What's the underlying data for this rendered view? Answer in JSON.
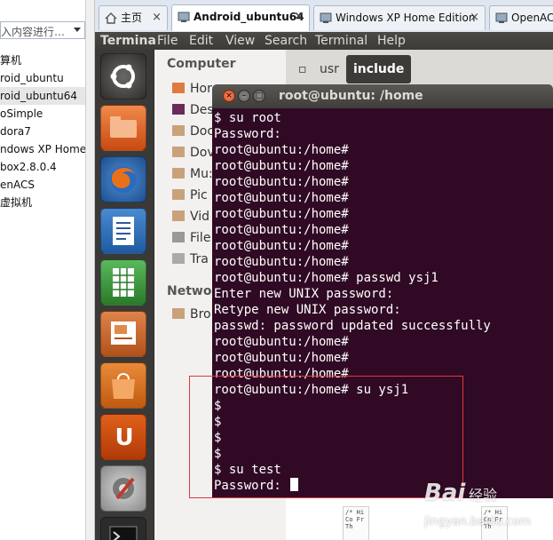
{
  "host": {
    "search_placeholder": "入内容进行…",
    "list_items": [
      "算机",
      "roid_ubuntu",
      "roid_ubuntu64",
      "oSimple",
      "dora7",
      "ndows XP Home E",
      "box2.8.0.4",
      "enACS",
      "虚拟机"
    ],
    "tabs": [
      {
        "label": "主页",
        "icon": "home-icon"
      },
      {
        "label": "Android_ubuntu64",
        "icon": "vm-icon"
      },
      {
        "label": "Windows XP Home Edition",
        "icon": "vm-icon"
      },
      {
        "label": "OpenACS",
        "icon": "vm-icon"
      }
    ],
    "close_glyph": "×"
  },
  "guest": {
    "topbar": {
      "app_name": "Termina",
      "menu": [
        "File",
        "Edit",
        "View",
        "Search",
        "Terminal",
        "Help"
      ]
    },
    "launcher": [
      {
        "name": "ubuntu-logo-icon",
        "glyph": "◉"
      },
      {
        "name": "files-icon",
        "glyph": ""
      },
      {
        "name": "firefox-icon",
        "glyph": ""
      },
      {
        "name": "writer-icon",
        "glyph": "≣"
      },
      {
        "name": "calc-icon",
        "glyph": "▦"
      },
      {
        "name": "impress-icon",
        "glyph": "▤"
      },
      {
        "name": "software-center-icon",
        "glyph": "▣"
      },
      {
        "name": "ubuntu-one-icon",
        "glyph": "U"
      },
      {
        "name": "settings-icon",
        "glyph": "⚙"
      },
      {
        "name": "terminal-icon",
        "glyph": ">_"
      }
    ],
    "files": {
      "heading_computer": "Computer",
      "places": [
        "Home",
        "Desktop",
        "Documents",
        "Downloads",
        "Music",
        "Pictures",
        "Videos",
        "File System",
        "Trash"
      ],
      "places_visible": [
        "Hor",
        "Des",
        "Doc",
        "Dov",
        "Mu:",
        "Pic",
        "Vid",
        "File",
        "Tra"
      ],
      "heading_network": "Networ",
      "network_item": "Bro",
      "path_buttons": [
        "usr",
        "include"
      ],
      "doc_thumb_text": "/* Hi\nCo\nFr\nTh"
    },
    "terminal": {
      "title": "root@ubuntu: /home",
      "lines": [
        "$ su root",
        "Password:",
        "root@ubuntu:/home#",
        "root@ubuntu:/home#",
        "root@ubuntu:/home#",
        "root@ubuntu:/home#",
        "root@ubuntu:/home#",
        "root@ubuntu:/home#",
        "root@ubuntu:/home#",
        "root@ubuntu:/home#",
        "root@ubuntu:/home# passwd ysj1",
        "Enter new UNIX password:",
        "Retype new UNIX password:",
        "passwd: password updated successfully",
        "root@ubuntu:/home#",
        "root@ubuntu:/home#",
        "root@ubuntu:/home#",
        "root@ubuntu:/home# su ysj1",
        "$",
        "$",
        "$",
        "$",
        "$ su test",
        "Password: "
      ],
      "colors": {
        "background": "#300a24",
        "text": "#ffffff"
      }
    }
  },
  "annotation_color": "#e0383d",
  "watermark": {
    "logo": "Bai",
    "sub": "经验",
    "url": "jingyan.baidu.com"
  }
}
